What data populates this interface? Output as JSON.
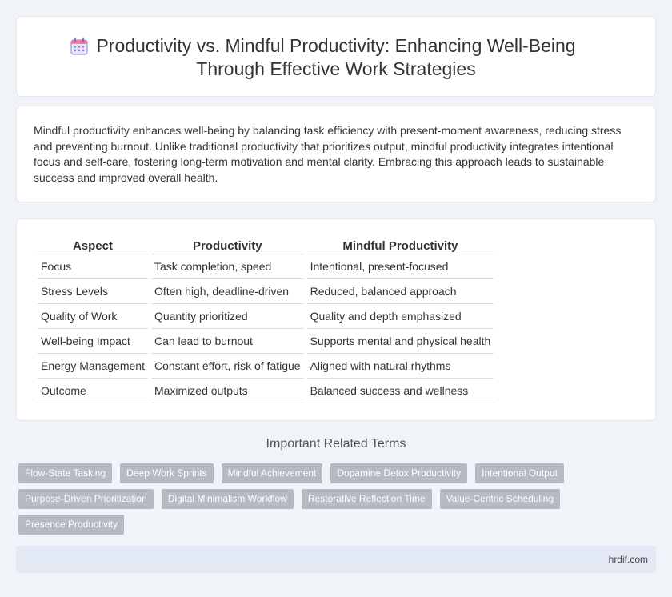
{
  "header": {
    "title_line1": "Productivity vs. Mindful Productivity: Enhancing Well-Being",
    "title_line2": "Through Effective Work Strategies",
    "icon": "calendar-icon"
  },
  "intro": {
    "text": "Mindful productivity enhances well-being by balancing task efficiency with present-moment awareness, reducing stress and preventing burnout. Unlike traditional productivity that prioritizes output, mindful productivity integrates intentional focus and self-care, fostering long-term motivation and mental clarity. Embracing this approach leads to sustainable success and improved overall health."
  },
  "table": {
    "headers": [
      "Aspect",
      "Productivity",
      "Mindful Productivity"
    ],
    "rows": [
      [
        "Focus",
        "Task completion, speed",
        "Intentional, present-focused"
      ],
      [
        "Stress Levels",
        "Often high, deadline-driven",
        "Reduced, balanced approach"
      ],
      [
        "Quality of Work",
        "Quantity prioritized",
        "Quality and depth emphasized"
      ],
      [
        "Well-being Impact",
        "Can lead to burnout",
        "Supports mental and physical health"
      ],
      [
        "Energy Management",
        "Constant effort, risk of fatigue",
        "Aligned with natural rhythms"
      ],
      [
        "Outcome",
        "Maximized outputs",
        "Balanced success and wellness"
      ]
    ]
  },
  "related": {
    "title": "Important Related Terms",
    "tags": [
      "Flow-State Tasking",
      "Deep Work Sprints",
      "Mindful Achievement",
      "Dopamine Detox Productivity",
      "Intentional Output",
      "Purpose-Driven Prioritization",
      "Digital Minimalism Workflow",
      "Restorative Reflection Time",
      "Value-Centric Scheduling",
      "Presence Productivity"
    ]
  },
  "footer": {
    "site": "hrdif.com"
  },
  "colors": {
    "background": "#f0f3f8",
    "tag_bg": "#b5bac3",
    "footer_bg": "#e4eaf5",
    "icon_accent": "#8a7fd6"
  }
}
